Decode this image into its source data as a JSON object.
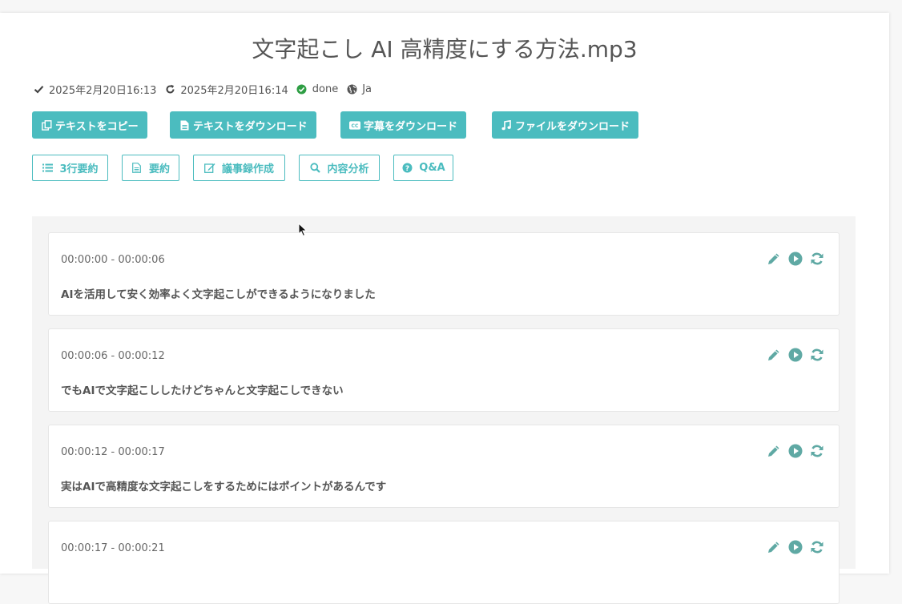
{
  "title": "文字起こし AI 高精度にする方法.mp3",
  "meta": {
    "created": "2025年2月20日16:13",
    "updated": "2025年2月20日16:14",
    "status": "done",
    "language": "Ja",
    "icons": [
      "check-icon",
      "refresh-icon",
      "check-circle-icon",
      "globe-icon"
    ]
  },
  "actions": {
    "copy_text": "テキストをコピー",
    "download_text": "テキストをダウンロード",
    "download_subtitles": "字幕をダウンロード",
    "download_file": "ファイルをダウンロード"
  },
  "ai_tools": {
    "three_line_summary": "3行要約",
    "summary": "要約",
    "minutes": "議事録作成",
    "content_analysis": "内容分析",
    "qa": "Q&A"
  },
  "segments": [
    {
      "time": "00:00:00 - 00:00:06",
      "text": "AIを活用して安く効率よく文字起こしができるようになりました"
    },
    {
      "time": "00:00:06 - 00:00:12",
      "text": "でもAIで文字起こししたけどちゃんと文字起こしできない"
    },
    {
      "time": "00:00:12 - 00:00:17",
      "text": "実はAIで高精度な文字起こしをするためにはポイントがあるんです"
    },
    {
      "time": "00:00:17 - 00:00:21",
      "text": ""
    }
  ],
  "colors": {
    "accent": "#4bbcbf",
    "icon_action": "#5fa9a4",
    "status_ok": "#2e9e44"
  }
}
